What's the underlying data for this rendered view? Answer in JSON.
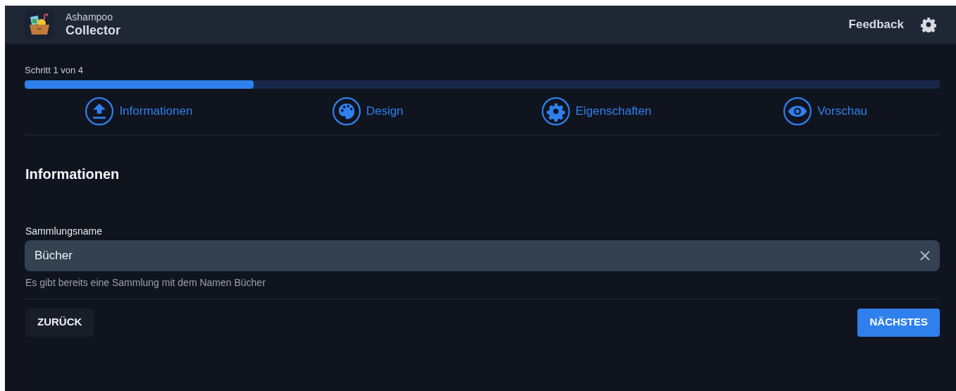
{
  "app": {
    "vendor": "Ashampoo",
    "name": "Collector"
  },
  "header_actions": {
    "feedback": "Feedback"
  },
  "progress": {
    "label": "Schritt 1 von 4",
    "level": 0.25
  },
  "steps": [
    {
      "label": "Informationen",
      "kind": "upload"
    },
    {
      "label": "Design",
      "kind": "palette"
    },
    {
      "label": "Eigenschaften",
      "kind": "gear"
    },
    {
      "label": "Vorschau",
      "kind": "eye"
    }
  ],
  "section_title": "Informationen",
  "field": {
    "label": "Sammlungsname",
    "value": "Bücher",
    "hint": "Es gibt bereits eine Sammlung mit dem Namen Bücher"
  },
  "buttons": {
    "back": "ZURÜCK",
    "next": "NÄCHSTES"
  }
}
